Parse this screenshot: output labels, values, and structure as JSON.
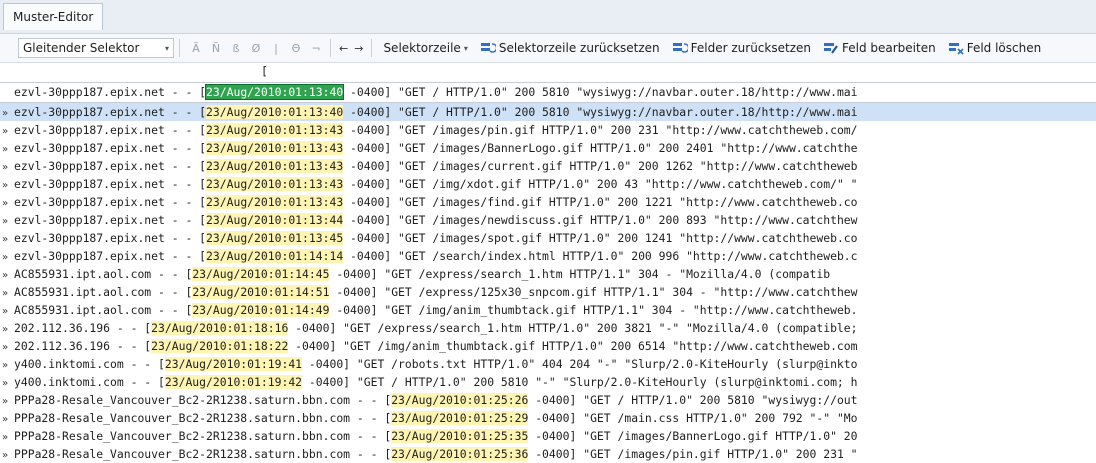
{
  "window": {
    "tab_title": "Muster-Editor"
  },
  "toolbar": {
    "selector_value": "Gleitender Selektor",
    "symbols": [
      "Ã",
      "Ñ",
      "ß",
      "Ø",
      "|",
      "Θ",
      "¬"
    ],
    "arrow_left": "←",
    "arrow_right": "→",
    "selektorzeile_label": "Selektorzeile",
    "reset_selector_row": "Selektorzeile zurücksetzen",
    "reset_fields": "Felder zurücksetzen",
    "edit_field": "Feld bearbeiten",
    "delete_field": "Feld löschen"
  },
  "editor": {
    "ruler_marker": "[",
    "pattern": {
      "pre": "ezvl-30ppp187.epix.net - - [",
      "field": "23/Aug/2010:01:13:40",
      "post": " -0400] \"GET / HTTP/1.0\" 200 5810 \"wysiwyg://navbar.outer.18/http://www.mai"
    },
    "rows": [
      {
        "pre": "ezvl-30ppp187.epix.net - - [",
        "ts": "23/Aug/2010:01:13:40",
        "post": " -0400] \"GET / HTTP/1.0\" 200 5810 \"wysiwyg://navbar.outer.18/http://www.mai"
      },
      {
        "pre": "ezvl-30ppp187.epix.net - - [",
        "ts": "23/Aug/2010:01:13:43",
        "post": " -0400] \"GET /images/pin.gif HTTP/1.0\" 200 231 \"http://www.catchtheweb.com/"
      },
      {
        "pre": "ezvl-30ppp187.epix.net - - [",
        "ts": "23/Aug/2010:01:13:43",
        "post": " -0400] \"GET /images/BannerLogo.gif HTTP/1.0\" 200 2401 \"http://www.catchthe"
      },
      {
        "pre": "ezvl-30ppp187.epix.net - - [",
        "ts": "23/Aug/2010:01:13:43",
        "post": " -0400] \"GET /images/current.gif HTTP/1.0\" 200 1262 \"http://www.catchtheweb"
      },
      {
        "pre": "ezvl-30ppp187.epix.net - - [",
        "ts": "23/Aug/2010:01:13:43",
        "post": " -0400] \"GET /img/xdot.gif HTTP/1.0\" 200 43 \"http://www.catchtheweb.com/\" \""
      },
      {
        "pre": "ezvl-30ppp187.epix.net - - [",
        "ts": "23/Aug/2010:01:13:43",
        "post": " -0400] \"GET /images/find.gif HTTP/1.0\" 200 1221 \"http://www.catchtheweb.co"
      },
      {
        "pre": "ezvl-30ppp187.epix.net - - [",
        "ts": "23/Aug/2010:01:13:44",
        "post": " -0400] \"GET /images/newdiscuss.gif HTTP/1.0\" 200 893 \"http://www.catchthew"
      },
      {
        "pre": "ezvl-30ppp187.epix.net - - [",
        "ts": "23/Aug/2010:01:13:45",
        "post": " -0400] \"GET /images/spot.gif HTTP/1.0\" 200 1241 \"http://www.catchtheweb.co"
      },
      {
        "pre": "ezvl-30ppp187.epix.net - - [",
        "ts": "23/Aug/2010:01:14:14",
        "post": " -0400] \"GET /search/index.html HTTP/1.0\" 200 996 \"http://www.catchtheweb.c"
      },
      {
        "pre": "AC855931.ipt.aol.com - - [",
        "ts": "23/Aug/2010:01:14:45",
        "post": " -0400] \"GET /express/search_1.htm HTTP/1.1\" 304 - \"Mozilla/4.0 (compatib"
      },
      {
        "pre": "AC855931.ipt.aol.com - - [",
        "ts": "23/Aug/2010:01:14:51",
        "post": " -0400] \"GET /express/125x30_snpcom.gif HTTP/1.1\" 304 - \"http://www.catchthew"
      },
      {
        "pre": "AC855931.ipt.aol.com - - [",
        "ts": "23/Aug/2010:01:14:49",
        "post": " -0400] \"GET /img/anim_thumbtack.gif HTTP/1.1\" 304 - \"http://www.catchtheweb."
      },
      {
        "pre": "202.112.36.196 - - [",
        "ts": "23/Aug/2010:01:18:16",
        "post": " -0400] \"GET /express/search_1.htm HTTP/1.0\" 200 3821 \"-\" \"Mozilla/4.0 (compatible;"
      },
      {
        "pre": "202.112.36.196 - - [",
        "ts": "23/Aug/2010:01:18:22",
        "post": " -0400] \"GET /img/anim_thumbtack.gif HTTP/1.0\" 200 6514 \"http://www.catchtheweb.com"
      },
      {
        "pre": "y400.inktomi.com - - [",
        "ts": "23/Aug/2010:01:19:41",
        "post": " -0400] \"GET /robots.txt HTTP/1.0\" 404 204 \"-\" \"Slurp/2.0-KiteHourly (slurp@inkto"
      },
      {
        "pre": "y400.inktomi.com - - [",
        "ts": "23/Aug/2010:01:19:42",
        "post": " -0400] \"GET / HTTP/1.0\" 200 5810 \"-\" \"Slurp/2.0-KiteHourly (slurp@inktomi.com; h"
      },
      {
        "pre": "PPPa28-Resale_Vancouver_Bc2-2R1238.saturn.bbn.com - - [",
        "ts": "23/Aug/2010:01:25:26",
        "post": " -0400] \"GET / HTTP/1.0\" 200 5810 \"wysiwyg://out"
      },
      {
        "pre": "PPPa28-Resale_Vancouver_Bc2-2R1238.saturn.bbn.com - - [",
        "ts": "23/Aug/2010:01:25:29",
        "post": " -0400] \"GET /main.css HTTP/1.0\" 200 792 \"-\" \"Mo"
      },
      {
        "pre": "PPPa28-Resale_Vancouver_Bc2-2R1238.saturn.bbn.com - - [",
        "ts": "23/Aug/2010:01:25:35",
        "post": " -0400] \"GET /images/BannerLogo.gif HTTP/1.0\" 20"
      },
      {
        "pre": "PPPa28-Resale_Vancouver_Bc2-2R1238.saturn.bbn.com - - [",
        "ts": "23/Aug/2010:01:25:36",
        "post": " -0400] \"GET /images/pin.gif HTTP/1.0\" 200 231 \""
      }
    ],
    "row_marker": "»",
    "selected_row_index": 0
  },
  "colors": {
    "field_highlight": "#fff5b3",
    "selected_row": "#cfe1f7",
    "active_field": "#2ea44f"
  }
}
